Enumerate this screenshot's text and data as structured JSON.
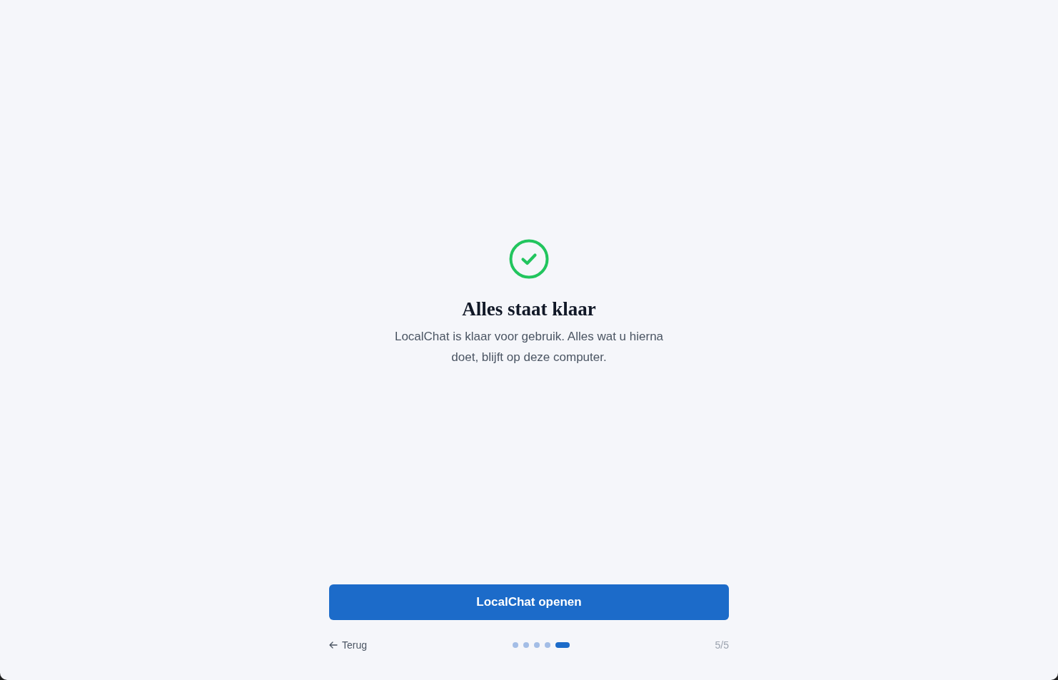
{
  "title": "Alles staat klaar",
  "message": "LocalChat is klaar voor gebruik. Alles wat u hierna doet, blijft op deze computer.",
  "primary_button": {
    "label": "LocalChat openen"
  },
  "back_button": {
    "label": "Terug"
  },
  "steps": [
    {
      "selected": false
    },
    {
      "selected": false
    },
    {
      "selected": false
    },
    {
      "selected": false
    },
    {
      "selected": true
    }
  ],
  "step_counter": "5/5"
}
